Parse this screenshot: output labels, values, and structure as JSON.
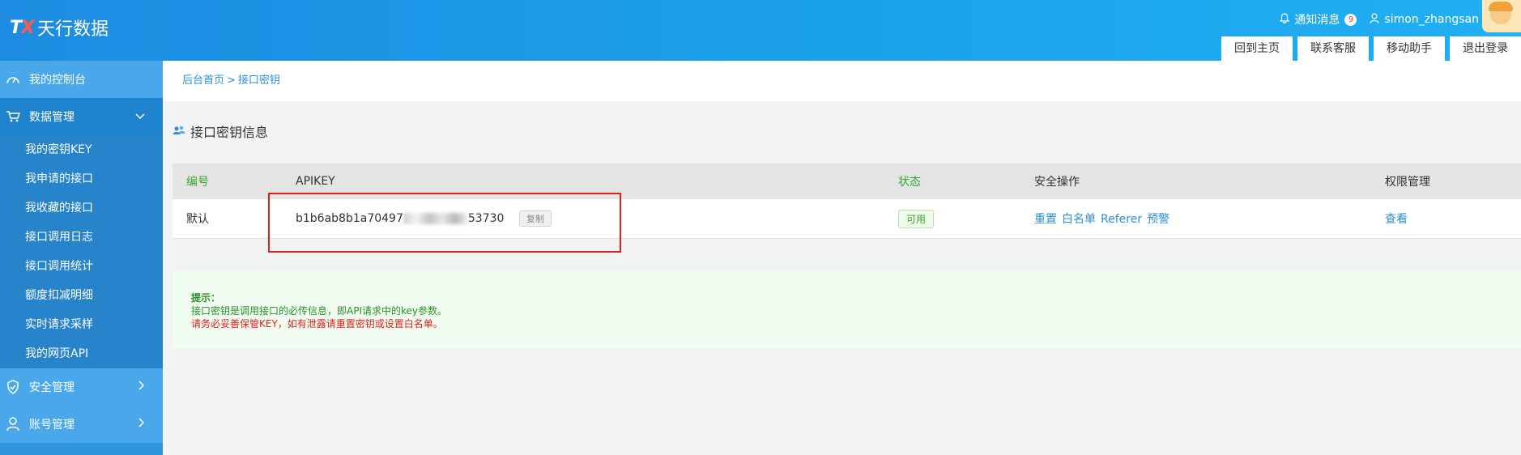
{
  "header": {
    "logo_mark": "TX",
    "logo_text": "天行数据",
    "notification_label": "通知消息",
    "notification_count": "9",
    "username": "simon_zhangsan",
    "nav_buttons": [
      "回到主页",
      "联系客服",
      "移动助手",
      "退出登录"
    ]
  },
  "sidebar": {
    "items": [
      {
        "label": "我的控制台",
        "icon": "dashboard-icon"
      },
      {
        "label": "数据管理",
        "icon": "cart-icon",
        "arrow": "⌄"
      },
      {
        "label": "安全管理",
        "icon": "shield-icon",
        "arrow": "›"
      },
      {
        "label": "账号管理",
        "icon": "user-icon",
        "arrow": "›"
      }
    ],
    "subitems": [
      "我的密钥KEY",
      "我申请的接口",
      "我收藏的接口",
      "接口调用日志",
      "接口调用统计",
      "额度扣减明细",
      "实时请求采样",
      "我的网页API"
    ]
  },
  "breadcrumb": {
    "home": "后台首页",
    "separator": ">",
    "current": "接口密钥"
  },
  "section": {
    "title": "接口密钥信息",
    "icon": "users-icon"
  },
  "table": {
    "headers": [
      "编号",
      "APIKEY",
      "状态",
      "安全操作",
      "权限管理"
    ],
    "row": {
      "id": "默认",
      "apikey_prefix": "b1b6ab8b1a70497",
      "apikey_suffix": "53730",
      "copy_label": "复制",
      "status": "可用",
      "ops": [
        "重置",
        "白名单",
        "Referer",
        "预警"
      ],
      "permission": "查看"
    }
  },
  "tips": {
    "title": "提示：",
    "line1": "接口密钥是调用接口的必传信息，即API请求中的key参数。",
    "line2": "请务必妥善保管KEY，如有泄露请重置密钥或设置白名单。"
  }
}
